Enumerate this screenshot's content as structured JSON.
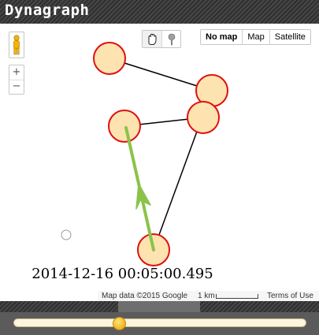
{
  "app": {
    "title": "Dynagraph"
  },
  "map_controls": {
    "map_types": [
      {
        "label": "No map",
        "active": true
      },
      {
        "label": "Map",
        "active": false
      },
      {
        "label": "Satellite",
        "active": false
      }
    ],
    "zoom_in_label": "+",
    "zoom_out_label": "−",
    "pegman_icon": "pegman-icon",
    "pan_tool_icon": "hand-icon",
    "marker_tool_icon": "marker-icon"
  },
  "timestamp": "2014-12-16 00:05:00.495",
  "footer": {
    "attribution": "Map data ©2015 Google",
    "scale_label": "1 km",
    "terms": "Terms of Use"
  },
  "slider": {
    "position": 0.36
  },
  "colors": {
    "node_fill": "#fde3b0",
    "node_stroke": "#e01010",
    "edge": "#000000",
    "arrow": "#8bc34a",
    "bar_dark": "#3a3a3a",
    "thumb": "#f2b61c"
  }
}
